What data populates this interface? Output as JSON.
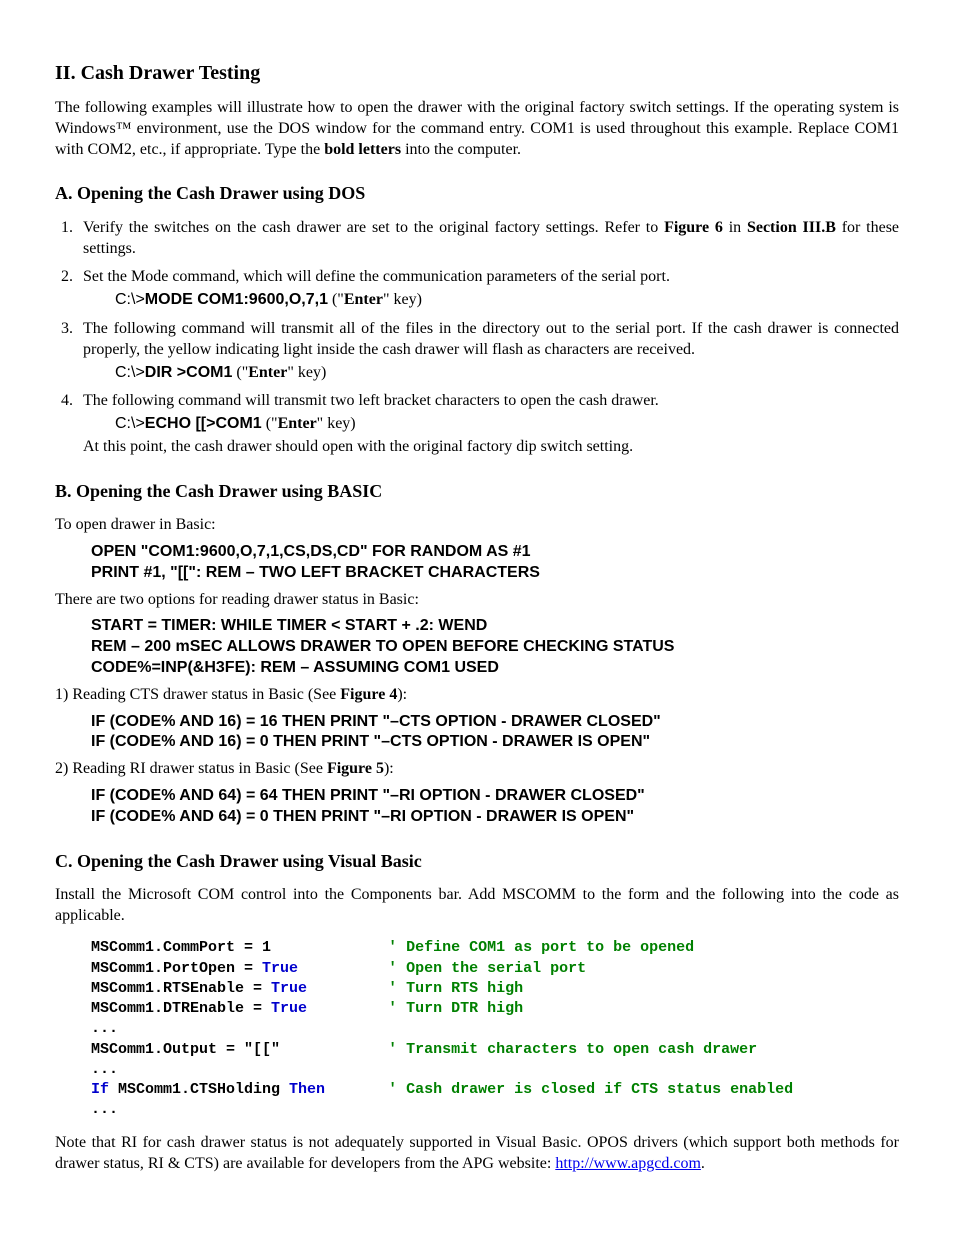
{
  "h_main": "II.  Cash Drawer Testing",
  "p_intro_a": "The following examples will illustrate how to open the drawer with the original factory switch settings.  If the operating system is Windows™ environment, use the DOS window for the command entry.  COM1 is used throughout this example.  Replace COM1 with COM2, etc., if appropriate.  Type the ",
  "p_intro_bold": "bold letters",
  "p_intro_b": " into the computer.",
  "h_a": "A.  Opening the Cash Drawer using DOS",
  "li1_a": "Verify the switches on the cash drawer are set to the original factory settings.  Refer to ",
  "li1_fig": "Figure 6",
  "li1_b": " in ",
  "li1_sec": "Section III.B",
  "li1_c": " for these settings.",
  "li2": "Set the Mode command, which will define the communication parameters of the serial port.",
  "cmd2_pre": "C:\\>",
  "cmd2_bold": "MODE COM1:9600,O,7,1",
  "cmd2_post_a": " (\"",
  "cmd2_enter": "Enter",
  "cmd2_post_b": "\" key)",
  "li3": "The following command will transmit all of the files in the directory out to the serial port.  If the cash drawer is connected properly, the yellow indicating light inside the cash drawer will flash as characters are received.",
  "cmd3_pre": "C:\\>",
  "cmd3_bold": "DIR >COM1",
  "li4": "The following command will transmit two left bracket characters to open the cash drawer.",
  "cmd4_pre": "C:\\>",
  "cmd4_bold": "ECHO [[>COM1",
  "li4_after": "At this point, the cash drawer should open with the original factory dip switch setting.",
  "h_b": "B.  Opening the Cash Drawer using BASIC",
  "b_p1": "To open drawer in Basic:",
  "b_code1_l1": "OPEN \"COM1:9600,O,7,1,CS,DS,CD\" FOR RANDOM AS #1",
  "b_code1_l2": "PRINT #1, \"[[\": REM – TWO LEFT BRACKET CHARACTERS",
  "b_p2": "There are two options for reading drawer status in Basic:",
  "b_code2_l1": "START = TIMER: WHILE TIMER < START + .2: WEND",
  "b_code2_l2": "REM – 200 mSEC ALLOWS DRAWER TO OPEN BEFORE CHECKING STATUS",
  "b_code2_l3": "CODE%=INP(&H3FE): REM – ASSUMING COM1 USED",
  "b_p3_a": "1) Reading CTS drawer status in Basic (See ",
  "b_p3_fig": "Figure 4",
  "b_p3_b": "):",
  "b_code3_l1": "IF (CODE% AND 16) = 16 THEN PRINT \"–CTS OPTION - DRAWER CLOSED\"",
  "b_code3_l2": "IF (CODE% AND 16) = 0 THEN PRINT \"–CTS OPTION - DRAWER IS OPEN\"",
  "b_p4_a": "2) Reading RI drawer status in Basic (See ",
  "b_p4_fig": "Figure 5",
  "b_p4_b": "):",
  "b_code4_l1": "IF (CODE% AND 64) = 64 THEN PRINT \"–RI OPTION - DRAWER CLOSED\"",
  "b_code4_l2": "IF (CODE% AND 64) = 0 THEN PRINT \"–RI OPTION - DRAWER IS OPEN\"",
  "h_c": "C.  Opening the Cash Drawer using Visual Basic",
  "c_p1": "Install the Microsoft COM control into the Components bar.  Add MSCOMM to the form and the following into the code as applicable.",
  "vb": {
    "l1a": "MSComm1.CommPort = 1             ",
    "l1c": "' Define COM1 as port to be opened",
    "l2a": "MSComm1.PortOpen = ",
    "l2k": "True",
    "l2p": "          ",
    "l2c": "' Open the serial port",
    "l3a": "MSComm1.RTSEnable = ",
    "l3k": "True",
    "l3p": "         ",
    "l3c": "' Turn RTS high",
    "l4a": "MSComm1.DTREnable = ",
    "l4k": "True",
    "l4p": "         ",
    "l4c": "' Turn DTR high",
    "dots": "...",
    "l5a": "MSComm1.Output = \"[[\"            ",
    "l5c": "' Transmit characters to open cash drawer",
    "l6k": "If",
    "l6a": " MSComm1.CTSHolding ",
    "l6k2": "Then",
    "l6p": "       ",
    "l6c": "' Cash drawer is closed if CTS status enabled"
  },
  "c_p2_a": "Note that RI for cash drawer status is not adequately supported in Visual Basic.  OPOS drivers (which support both methods for drawer status, RI & CTS) are available for developers from the APG website: ",
  "c_link": "http://www.apgcd.com",
  "c_p2_b": "."
}
